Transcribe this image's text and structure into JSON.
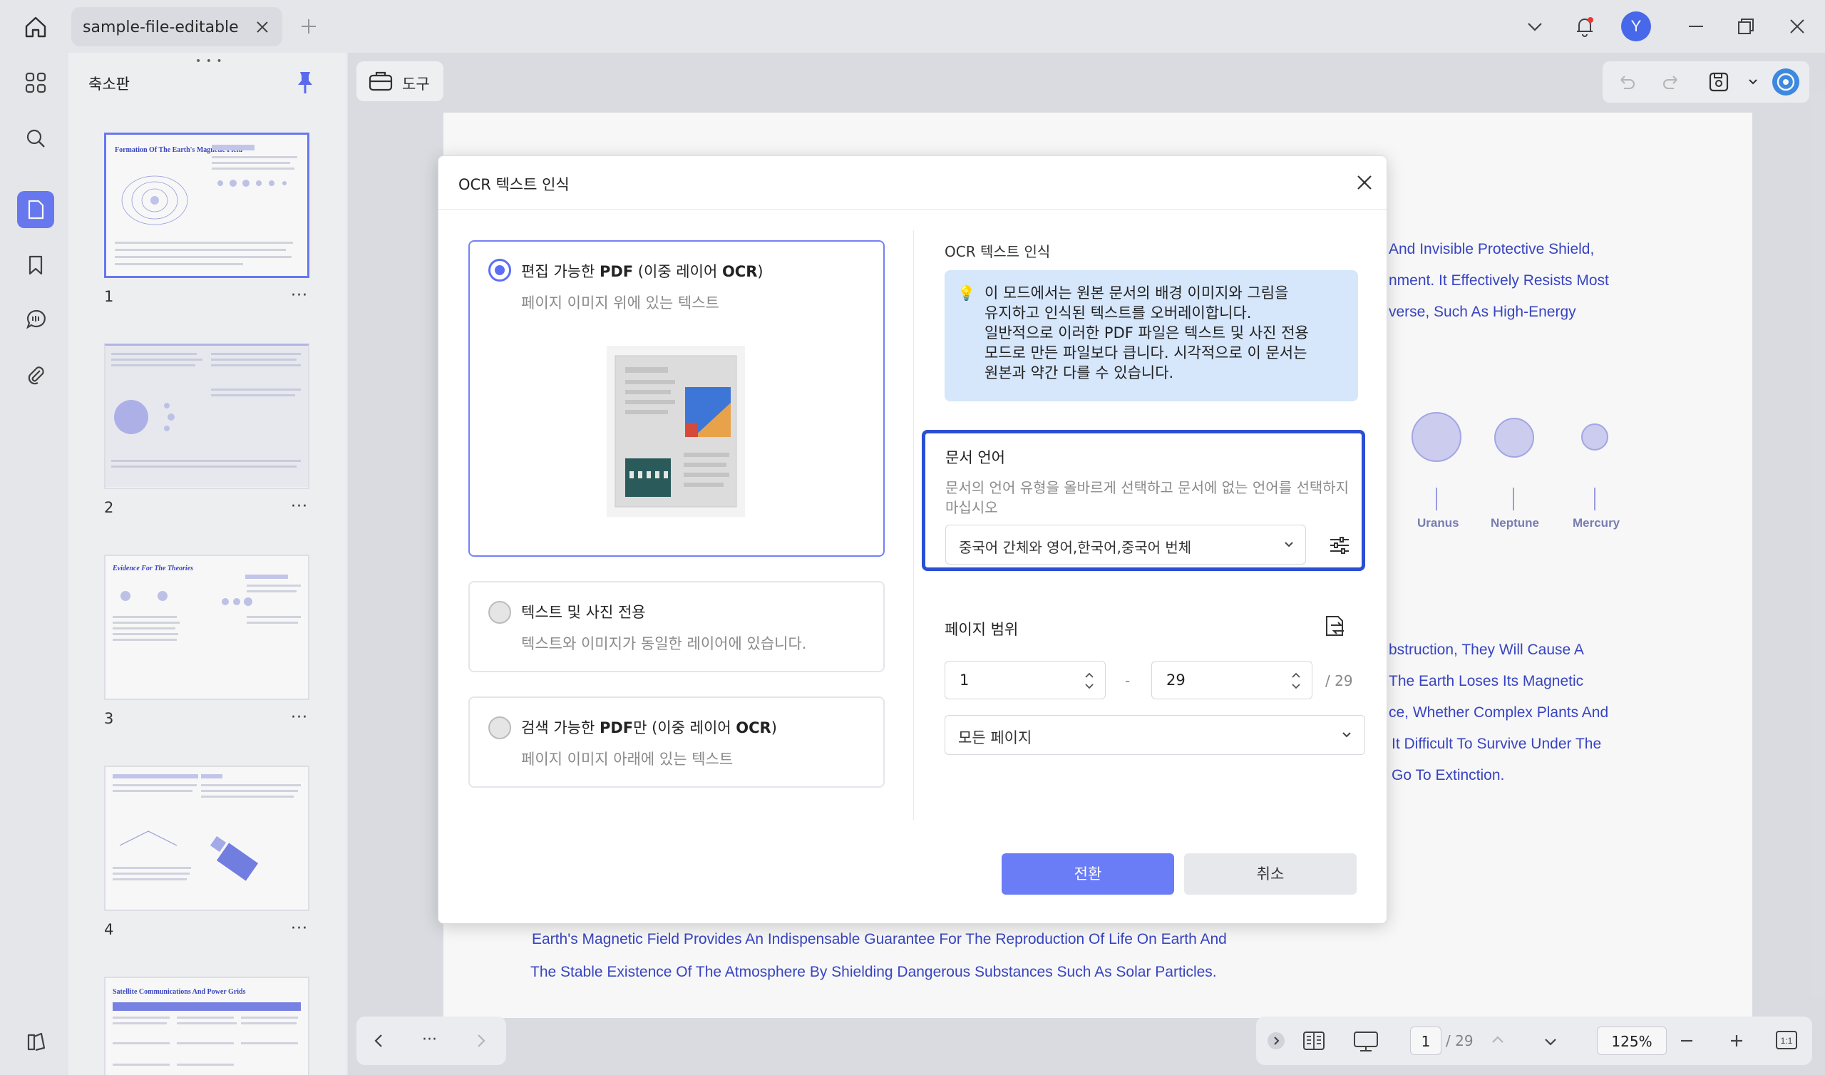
{
  "tab": {
    "title": "sample-file-editable"
  },
  "titlebar": {
    "avatar_letter": "Y"
  },
  "sidebar": {
    "panel_title": "축소판",
    "items": [
      "apps",
      "search",
      "thumbnails",
      "bookmark",
      "comment",
      "attachment",
      "layers"
    ],
    "active": "thumbnails"
  },
  "thumbnails": [
    {
      "page": "1",
      "title": "Formation Of The Earth's Magnetic Field"
    },
    {
      "page": "2",
      "title": ""
    },
    {
      "page": "3",
      "title": "Evidence For The Theories"
    },
    {
      "page": "4",
      "title": ""
    },
    {
      "page": "",
      "title": "Satellite Communications And Power Grids"
    }
  ],
  "thumb_more": "···",
  "toolbar": {
    "tools_label": "도구"
  },
  "document": {
    "right_lines": [
      "And Invisible Protective Shield,",
      "nment. It Effectively Resists Most",
      "verse, Such As High-Energy"
    ],
    "planets": [
      "Uranus",
      "Neptune",
      "Mercury"
    ],
    "lower_lines": [
      "bstruction, They Will Cause A",
      "The Earth Loses Its Magnetic",
      "ce, Whether Complex Plants And",
      "It Difficult To Survive Under The",
      "Go To Extinction."
    ],
    "bottom_lines": [
      "Earth's Magnetic Field Provides An Indispensable Guarantee For The Reproduction Of Life On Earth And",
      "The Stable Existence Of The Atmosphere By Shielding Dangerous Substances Such As Solar Particles."
    ]
  },
  "bottom_nav": {
    "ellipsis": "···",
    "current_page": "1",
    "total_pages": "/ 29",
    "zoom": "125%"
  },
  "dialog": {
    "title": "OCR 텍스트 인식",
    "modes": [
      {
        "title_prefix": "편집 가능한 ",
        "title_bold1": "PDF",
        "title_mid": " (이중 레이어 ",
        "title_bold2": "OCR",
        "title_suffix": ")",
        "subtitle": "페이지 이미지 위에 있는 텍스트",
        "selected": true
      },
      {
        "title_prefix": "텍스트 및 사진 전용",
        "title_bold1": "",
        "title_mid": "",
        "title_bold2": "",
        "title_suffix": "",
        "subtitle": "텍스트와 이미지가 동일한 레이어에 있습니다.",
        "selected": false
      },
      {
        "title_prefix": "검색 가능한 ",
        "title_bold1": "PDF",
        "title_mid": "만 (이중 레이어 ",
        "title_bold2": "OCR",
        "title_suffix": ")",
        "subtitle": "페이지 이미지 아래에 있는 텍스트",
        "selected": false
      }
    ],
    "right_title": "OCR 텍스트 인식",
    "info": "이 모드에서는 원본 문서의 배경 이미지와 그림을\n유지하고 인식된 텍스트를 오버레이합니다.\n일반적으로 이러한 PDF 파일은 텍스트 및 사진 전용\n모드로 만든 파일보다 큽니다. 시각적으로 이 문서는\n원본과 약간 다를 수 있습니다.",
    "language": {
      "title": "문서 언어",
      "description": "문서의 언어 유형을 올바르게 선택하고 문서에 없는 언어를 선택하지 마십시오",
      "selected": "중국어 간체와 영어,한국어,중국어 번체"
    },
    "page_range": {
      "title": "페이지 범위",
      "from": "1",
      "separator": "-",
      "to": "29",
      "of_total": "/ 29",
      "scope": "모든 페이지"
    },
    "convert_label": "전환",
    "cancel_label": "취소"
  },
  "colors": {
    "accent": "#6b7cf7",
    "focus_border": "#2a4fd6",
    "info_bg": "#d6e6fb",
    "doc_text": "#3a47c8"
  }
}
